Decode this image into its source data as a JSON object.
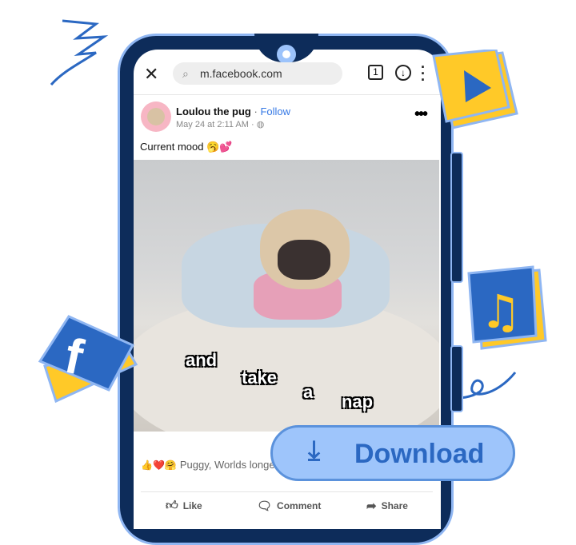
{
  "browser": {
    "url": "m.facebook.com",
    "tab_count": "1"
  },
  "post": {
    "author": "Loulou the pug",
    "separator": "·",
    "follow": "Follow",
    "timestamp": "May 24 at 2:11 AM ·",
    "text": "Current mood 🥱💕",
    "reactions_text": "Puggy, Worlds longe",
    "captions": [
      "and",
      "take",
      "a",
      "nap"
    ]
  },
  "actions": {
    "like": "Like",
    "comment": "Comment",
    "share": "Share"
  },
  "download_button": {
    "label": "Download"
  },
  "colors": {
    "phone": "#0d2c5a",
    "accent": "#2b68c2",
    "button_bg": "#9ec5fb",
    "cube_yellow": "#ffc928"
  }
}
